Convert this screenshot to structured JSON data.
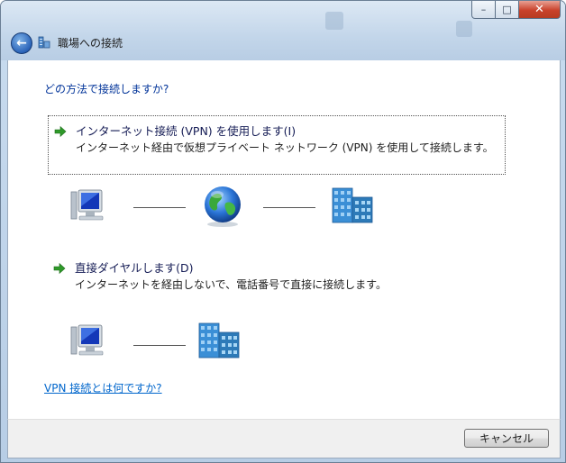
{
  "window": {
    "title": "職場への接続",
    "buttons": {
      "minimize": "–",
      "maximize": "□",
      "close": "✕"
    }
  },
  "main": {
    "question": "どの方法で接続しますか?",
    "options": [
      {
        "title": "インターネット接続 (VPN) を使用します(I)",
        "description": "インターネット経由で仮想プライベート ネットワーク (VPN) を使用して接続します。"
      },
      {
        "title": "直接ダイヤルします(D)",
        "description": "インターネットを経由しないで、電話番号で直接に接続します。"
      }
    ],
    "help_link": "VPN 接続とは何ですか?"
  },
  "footer": {
    "cancel_label": "キャンセル"
  },
  "colors": {
    "accent": "#003399",
    "link": "#0066cc",
    "arrow": "#2f9a2a"
  },
  "icons": [
    "back-arrow-icon",
    "network-connection-icon",
    "green-arrow-icon",
    "computer-icon",
    "globe-icon",
    "office-building-icon"
  ]
}
